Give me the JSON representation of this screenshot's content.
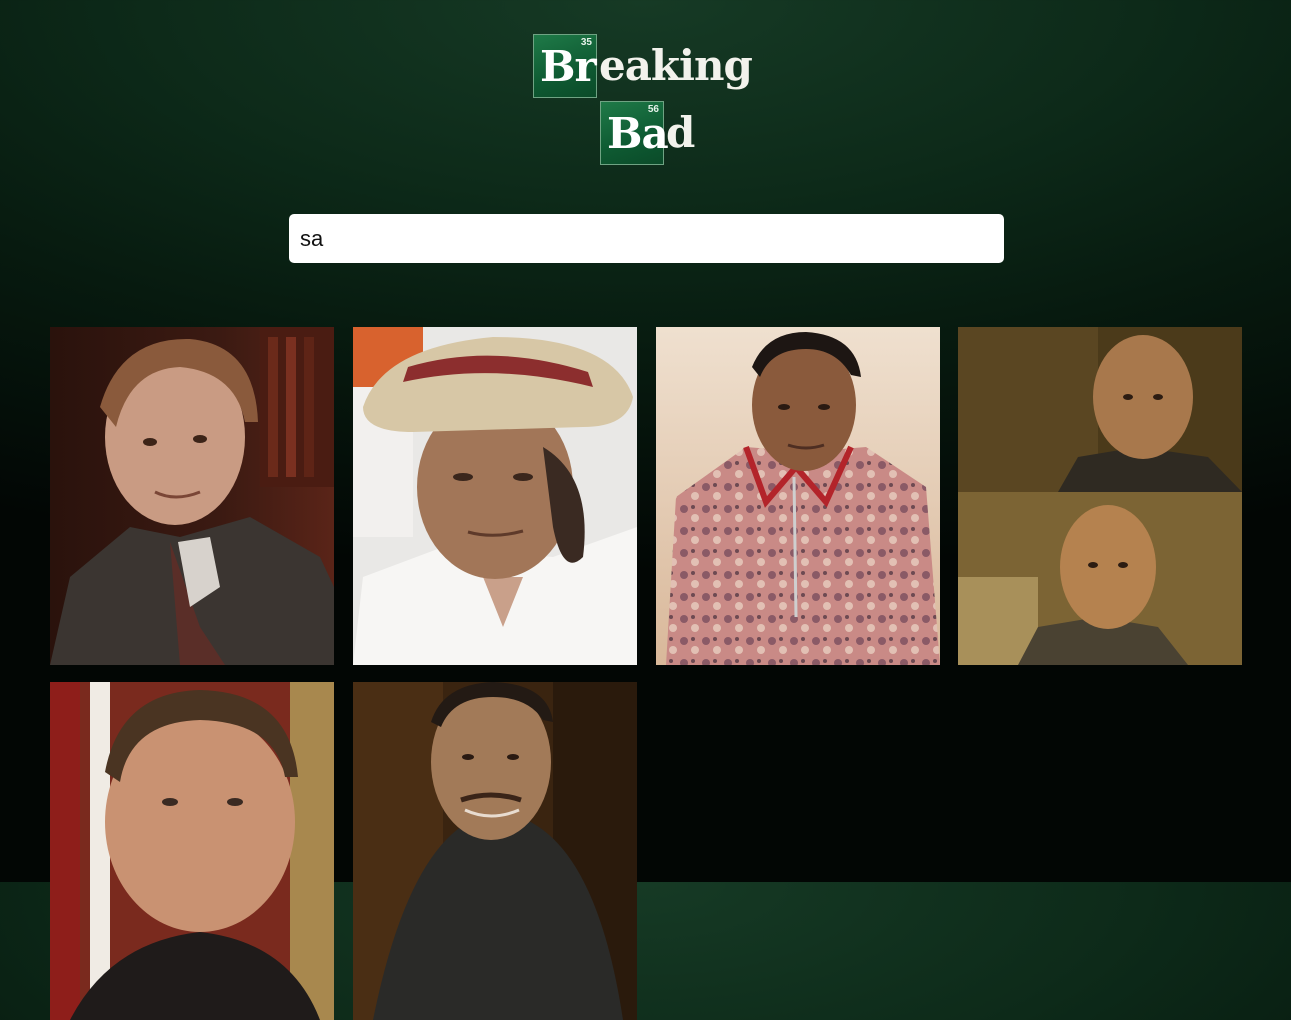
{
  "logo": {
    "element1": {
      "symbol": "Br",
      "number": "35"
    },
    "rest1": "eaking",
    "element2": {
      "symbol": "Ba",
      "number": "56"
    },
    "rest2": "d"
  },
  "search": {
    "value": "sa"
  },
  "results": [
    {
      "photo": "man-in-suit-office"
    },
    {
      "photo": "old-man-straw-hat"
    },
    {
      "photo": "man-floral-shirt-desert"
    },
    {
      "photo": "bald-man-two-frames"
    },
    {
      "photo": "man-in-red-room"
    },
    {
      "photo": "smiling-man-dark-room"
    }
  ]
}
